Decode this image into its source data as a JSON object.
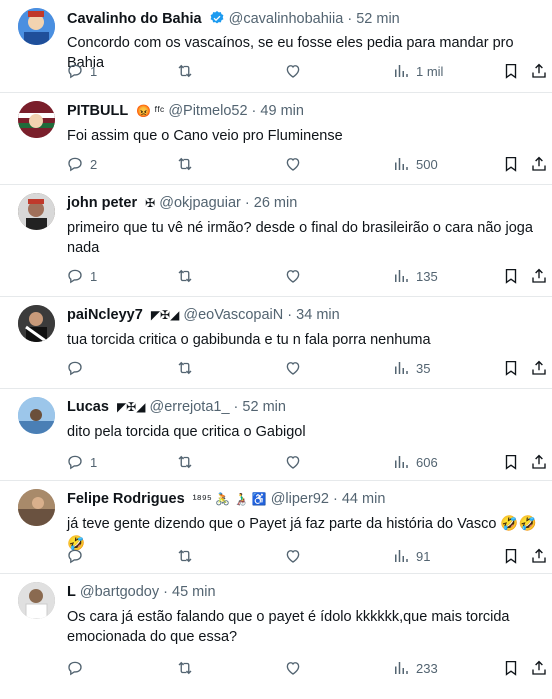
{
  "tweets": [
    {
      "name": "Cavalinho do Bahia",
      "verified": true,
      "symbols": "",
      "handle": "@cavalinhobahiia",
      "time": "52 min",
      "text": "Concordo com os vascaínos, se eu fosse eles pedia para mandar pro Bahia",
      "replies": "1",
      "views": "1 mil",
      "avatar_color": "#3a7bd5"
    },
    {
      "name": "PITBULL",
      "verified": false,
      "symbols": "😡 ᶠᶠᶜ",
      "handle": "@Pitmelo52",
      "time": "49 min",
      "text": "Foi assim que o Cano veio pro Fluminense",
      "replies": "2",
      "views": "500",
      "avatar_color": "#7a1f2b"
    },
    {
      "name": "john peter",
      "verified": false,
      "symbols": "✠",
      "handle": "@okjpaguiar",
      "time": "26 min",
      "text": "primeiro que tu vê né irmão? desde o final do brasileirão o cara não joga nada",
      "replies": "1",
      "views": "135",
      "avatar_color": "#5a4a3a"
    },
    {
      "name": "paiNcleyy7",
      "verified": false,
      "symbols": "◤✠◢",
      "handle": "@eoVascopaiN",
      "time": "34 min",
      "text": "tua torcida critica o gabibunda e tu n fala porra nenhuma",
      "replies": "",
      "views": "35",
      "avatar_color": "#3b3b3b"
    },
    {
      "name": "Lucas",
      "verified": false,
      "symbols": "◤✠◢",
      "handle": "@errejota1_",
      "time": "52 min",
      "text": "dito pela torcida que critica o Gabigol",
      "replies": "1",
      "views": "606",
      "avatar_color": "#6fa8dc"
    },
    {
      "name": "Felipe Rodrigues",
      "verified": false,
      "symbols": "¹⁸⁹⁵ 🚴 👨‍🦽 ♿",
      "handle": "@liper92",
      "time": "44 min",
      "text": "já teve gente dizendo que o Payet já faz parte da história do Vasco 🤣🤣🤣",
      "replies": "",
      "views": "91",
      "avatar_color": "#8a7058"
    },
    {
      "name": "L",
      "verified": false,
      "symbols": "",
      "handle": "@bartgodoy",
      "time": "45 min",
      "text": "Os cara já estão falando que o payet é ídolo kkkkkk,que mais torcida emocionada do que essa?",
      "replies": "",
      "views": "233",
      "avatar_color": "#9a9a9a"
    }
  ],
  "icons": {
    "reply": "reply-icon",
    "retweet": "retweet-icon",
    "like": "like-icon",
    "views": "views-icon",
    "bookmark": "bookmark-icon",
    "share": "share-icon"
  }
}
